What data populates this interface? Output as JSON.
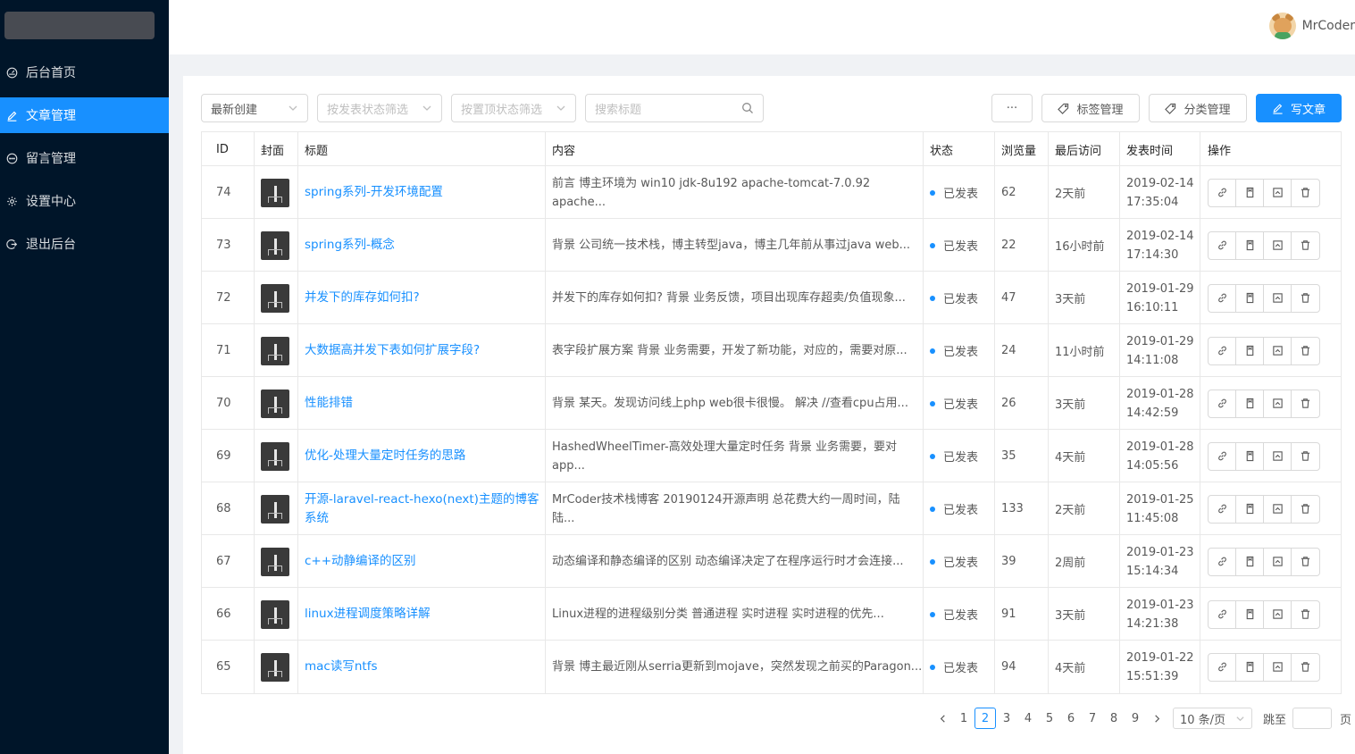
{
  "header": {
    "username": "MrCoder"
  },
  "sidebar": {
    "items": [
      {
        "label": "后台首页",
        "icon": "dashboard-icon"
      },
      {
        "label": "文章管理",
        "icon": "edit-icon",
        "active": true
      },
      {
        "label": "留言管理",
        "icon": "message-icon"
      },
      {
        "label": "设置中心",
        "icon": "setting-icon"
      },
      {
        "label": "退出后台",
        "icon": "logout-icon"
      }
    ]
  },
  "toolbar": {
    "sort_value": "最新创建",
    "status_filter_placeholder": "按发表状态筛选",
    "top_filter_placeholder": "按置顶状态筛选",
    "search_placeholder": "搜索标题",
    "more_label": "···",
    "tag_button": "标签管理",
    "category_button": "分类管理",
    "write_button": "写文章"
  },
  "table": {
    "columns": [
      "ID",
      "封面",
      "标题",
      "内容",
      "状态",
      "浏览量",
      "最后访问",
      "发表时间",
      "操作"
    ],
    "rows": [
      {
        "id": "74",
        "title": "spring系列-开发环境配置",
        "content": "前言 博主环境为 win10 jdk-8u192 apache-tomcat-7.0.92 apache...",
        "status": "已发表",
        "views": "62",
        "last": "2天前",
        "date": "2019-02-14",
        "time": "17:35:04"
      },
      {
        "id": "73",
        "title": "spring系列-概念",
        "content": "背景 公司统一技术栈，博主转型java，博主几年前从事过java web...",
        "status": "已发表",
        "views": "22",
        "last": "16小时前",
        "date": "2019-02-14",
        "time": "17:14:30"
      },
      {
        "id": "72",
        "title": "并发下的库存如何扣?",
        "content": "并发下的库存如何扣? 背景 业务反馈，项目出现库存超卖/负值现象...",
        "status": "已发表",
        "views": "47",
        "last": "3天前",
        "date": "2019-01-29",
        "time": "16:10:11"
      },
      {
        "id": "71",
        "title": "大数据高并发下表如何扩展字段?",
        "content": "表字段扩展方案 背景 业务需要，开发了新功能，对应的，需要对原...",
        "status": "已发表",
        "views": "24",
        "last": "11小时前",
        "date": "2019-01-29",
        "time": "14:11:08"
      },
      {
        "id": "70",
        "title": "性能排错",
        "content": "背景 某天。发现访问线上php web很卡很慢。 解决 //查看cpu占用...",
        "status": "已发表",
        "views": "26",
        "last": "3天前",
        "date": "2019-01-28",
        "time": "14:42:59"
      },
      {
        "id": "69",
        "title": "优化-处理大量定时任务的思路",
        "content": "HashedWheelTimer-高效处理大量定时任务 背景 业务需要，要对app...",
        "status": "已发表",
        "views": "35",
        "last": "4天前",
        "date": "2019-01-28",
        "time": "14:05:56"
      },
      {
        "id": "68",
        "title": "开源-laravel-react-hexo(next)主题的博客系统",
        "content": "MrCoder技术栈博客 20190124开源声明 总花费大约一周时间，陆陆...",
        "status": "已发表",
        "views": "133",
        "last": "2天前",
        "date": "2019-01-25",
        "time": "11:45:08"
      },
      {
        "id": "67",
        "title": "c++动静编译的区别",
        "content": "动态编译和静态编译的区别 动态编译决定了在程序运行时才会连接...",
        "status": "已发表",
        "views": "39",
        "last": "2周前",
        "date": "2019-01-23",
        "time": "15:14:34"
      },
      {
        "id": "66",
        "title": "linux进程调度策略详解",
        "content": "Linux进程的进程级别分类 普通进程 实时进程 实时进程的优先...",
        "status": "已发表",
        "views": "91",
        "last": "3天前",
        "date": "2019-01-23",
        "time": "14:21:38"
      },
      {
        "id": "65",
        "title": "mac读写ntfs",
        "content": "背景 博主最近刚从serria更新到mojave，突然发现之前买的Paragon...",
        "status": "已发表",
        "views": "94",
        "last": "4天前",
        "date": "2019-01-22",
        "time": "15:51:39"
      }
    ]
  },
  "pagination": {
    "pages": [
      "1",
      "2",
      "3",
      "4",
      "5",
      "6",
      "7",
      "8",
      "9"
    ],
    "current": "2",
    "page_size": "10 条/页",
    "jump_label": "跳至",
    "jump_suffix": "页"
  },
  "colors": {
    "sidebar_bg": "#001529",
    "primary": "#1890ff"
  }
}
